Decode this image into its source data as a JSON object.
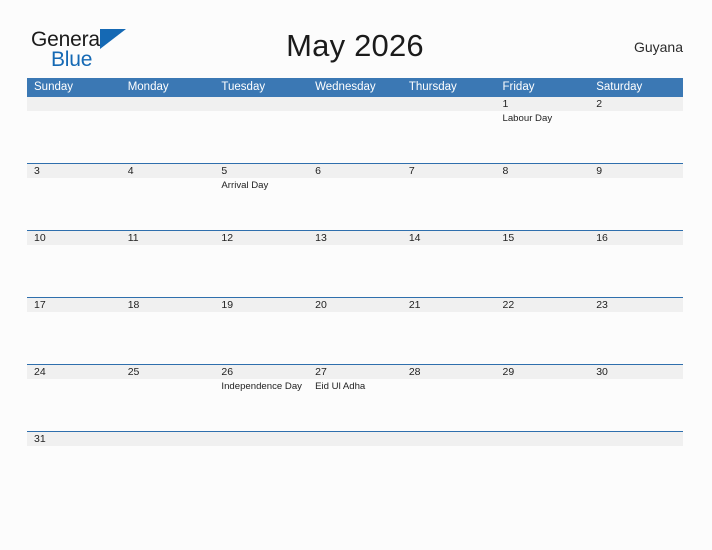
{
  "brand": {
    "name_part1": "General",
    "name_part2": "Blue",
    "triangle_icon": "triangle-icon",
    "color_dark": "#1b1b1b",
    "color_blue": "#1569b4"
  },
  "header": {
    "title": "May 2026",
    "country": "Guyana",
    "accent_color": "#3b78b4",
    "rule_color": "#2f6fad",
    "number_band_color": "#f0f0f0"
  },
  "calendar": {
    "day_headers": [
      "Sunday",
      "Monday",
      "Tuesday",
      "Wednesday",
      "Thursday",
      "Friday",
      "Saturday"
    ],
    "weeks": [
      {
        "size": "tall",
        "days": [
          {
            "number": "",
            "event": ""
          },
          {
            "number": "",
            "event": ""
          },
          {
            "number": "",
            "event": ""
          },
          {
            "number": "",
            "event": ""
          },
          {
            "number": "",
            "event": ""
          },
          {
            "number": "1",
            "event": "Labour Day"
          },
          {
            "number": "2",
            "event": ""
          }
        ]
      },
      {
        "size": "tall",
        "days": [
          {
            "number": "3",
            "event": ""
          },
          {
            "number": "4",
            "event": ""
          },
          {
            "number": "5",
            "event": "Arrival Day"
          },
          {
            "number": "6",
            "event": ""
          },
          {
            "number": "7",
            "event": ""
          },
          {
            "number": "8",
            "event": ""
          },
          {
            "number": "9",
            "event": ""
          }
        ]
      },
      {
        "size": "tall",
        "days": [
          {
            "number": "10",
            "event": ""
          },
          {
            "number": "11",
            "event": ""
          },
          {
            "number": "12",
            "event": ""
          },
          {
            "number": "13",
            "event": ""
          },
          {
            "number": "14",
            "event": ""
          },
          {
            "number": "15",
            "event": ""
          },
          {
            "number": "16",
            "event": ""
          }
        ]
      },
      {
        "size": "tall",
        "days": [
          {
            "number": "17",
            "event": ""
          },
          {
            "number": "18",
            "event": ""
          },
          {
            "number": "19",
            "event": ""
          },
          {
            "number": "20",
            "event": ""
          },
          {
            "number": "21",
            "event": ""
          },
          {
            "number": "22",
            "event": ""
          },
          {
            "number": "23",
            "event": ""
          }
        ]
      },
      {
        "size": "tall",
        "days": [
          {
            "number": "24",
            "event": ""
          },
          {
            "number": "25",
            "event": ""
          },
          {
            "number": "26",
            "event": "Independence Day"
          },
          {
            "number": "27",
            "event": "Eid Ul Adha"
          },
          {
            "number": "28",
            "event": ""
          },
          {
            "number": "29",
            "event": ""
          },
          {
            "number": "30",
            "event": ""
          }
        ]
      },
      {
        "size": "short",
        "days": [
          {
            "number": "31",
            "event": ""
          },
          {
            "number": "",
            "event": ""
          },
          {
            "number": "",
            "event": ""
          },
          {
            "number": "",
            "event": ""
          },
          {
            "number": "",
            "event": ""
          },
          {
            "number": "",
            "event": ""
          },
          {
            "number": "",
            "event": ""
          }
        ]
      }
    ]
  }
}
